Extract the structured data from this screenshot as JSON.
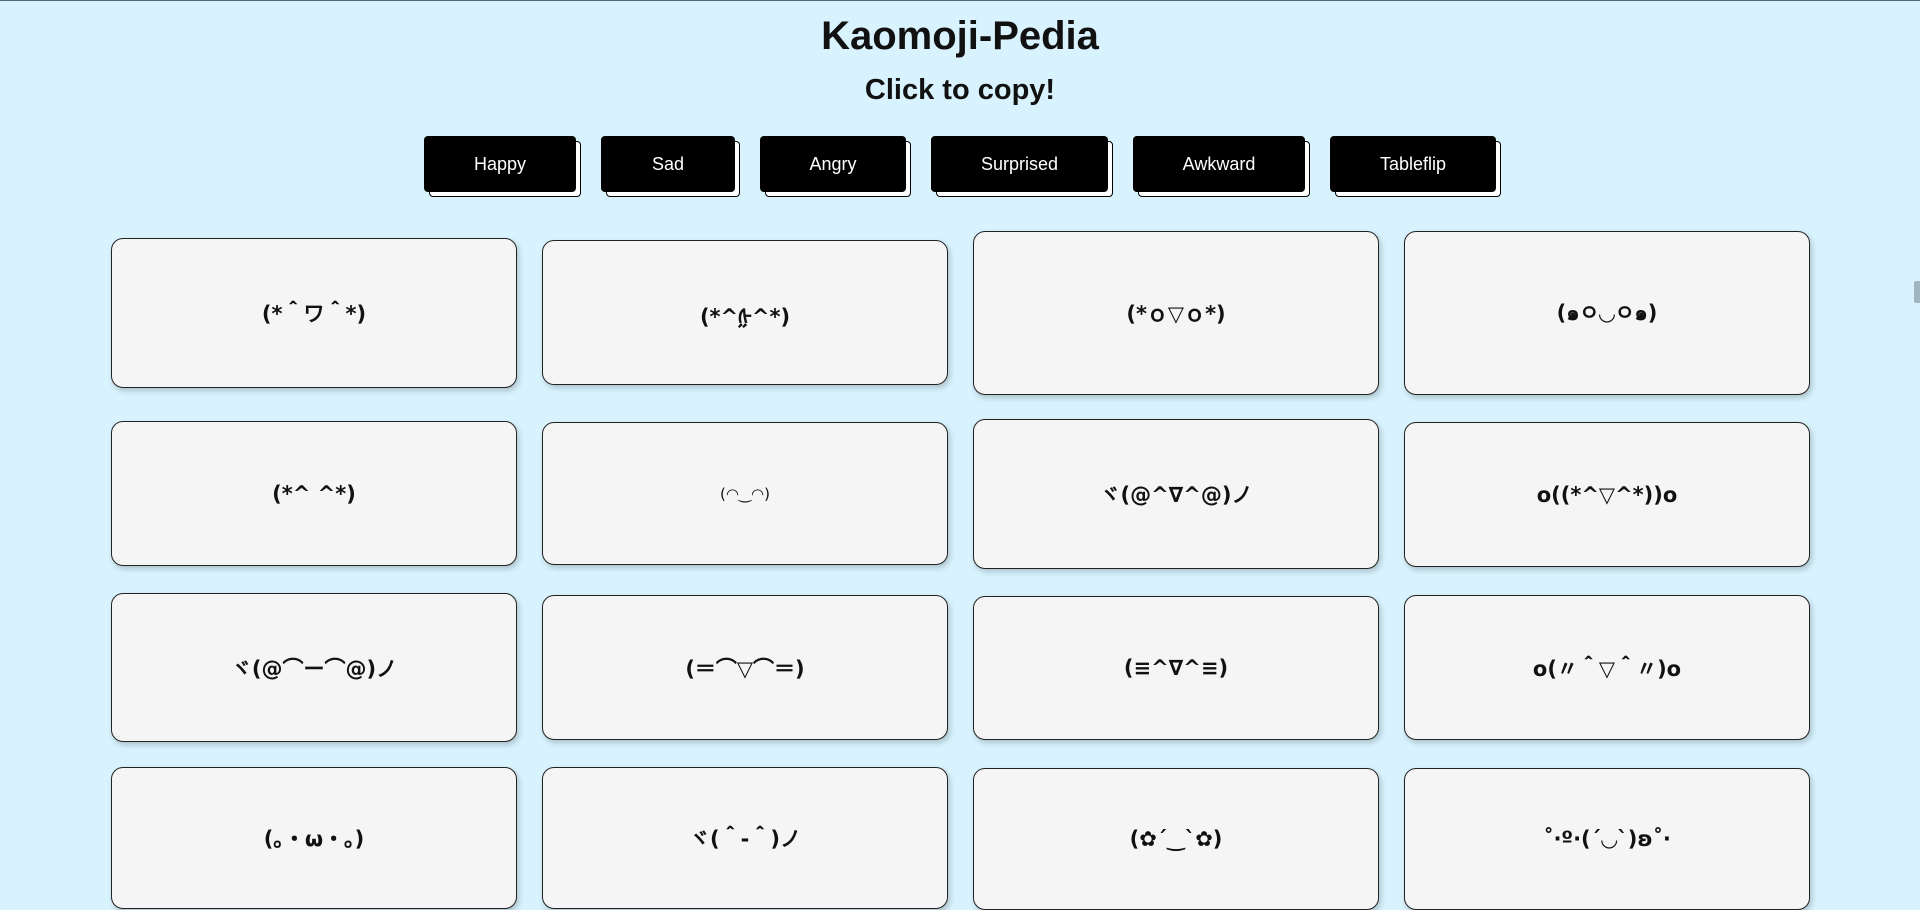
{
  "header": {
    "title": "Kaomoji-Pedia",
    "subtitle": "Click to copy!"
  },
  "categories": [
    "Happy",
    "Sad",
    "Angry",
    "Surprised",
    "Awkward",
    "Tableflip"
  ],
  "kaomoji": [
    "(*＾ワ＾*)",
    "(*^ᢔ^*)",
    "(*ｏ▽ｏ*)",
    "(๑ㅇ◡ㅇ๑)",
    "(*^ ^*)",
    "(◠‿◠)",
    "ヾ(@^∇^@)ノ",
    "o((*^▽^*))o",
    "ヾ(@⌒ー⌒@)ノ",
    "(＝⌒▽⌒＝)",
    "(≡^∇^≡)",
    "o(〃＾▽＾〃)o",
    "(｡・ω・｡)",
    "ヾ(＾-＾)ノ",
    "(✿´‿`✿)",
    "˚‧º·(´◡`)ʚ˚‧"
  ],
  "colors": {
    "background": "#d8f3fe",
    "card": "#f5f5f5",
    "button": "#000000"
  }
}
